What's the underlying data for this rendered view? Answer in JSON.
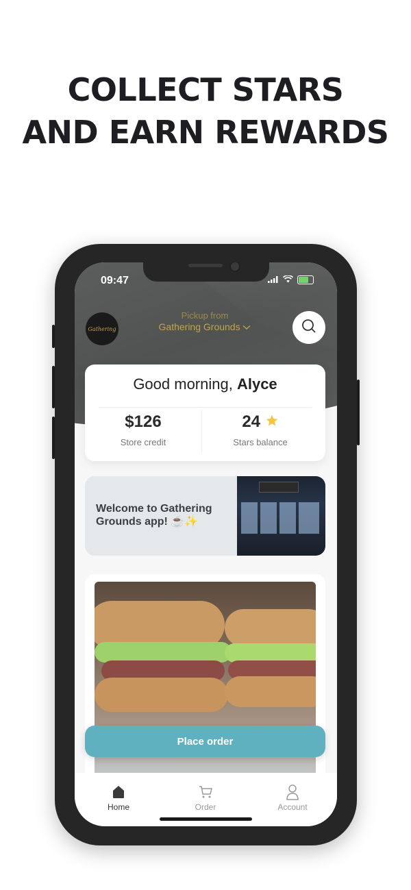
{
  "headline": {
    "line1": "COLLECT STARS",
    "line2": "AND EARN REWARDS"
  },
  "status_bar": {
    "time": "09:47"
  },
  "header": {
    "logo_text": "Gathering",
    "pickup_label": "Pickup from",
    "pickup_location": "Gathering Grounds",
    "chevron": "chevron-down-icon",
    "search_icon": "search-icon"
  },
  "greeting": {
    "prefix": "Good morning, ",
    "name": "Alyce",
    "store_credit_value": "$126",
    "store_credit_label": "Store credit",
    "stars_value": "24",
    "stars_label": "Stars balance"
  },
  "welcome": {
    "text": "Welcome to Gathering Grounds app! ☕✨"
  },
  "cta": {
    "place_order": "Place order"
  },
  "tabs": [
    {
      "label": "Home",
      "icon": "home-icon",
      "active": true
    },
    {
      "label": "Order",
      "icon": "cart-icon",
      "active": false
    },
    {
      "label": "Account",
      "icon": "user-icon",
      "active": false
    }
  ],
  "colors": {
    "accent": "#5fb1c0",
    "gold": "#c0a546",
    "star": "#f5c542"
  }
}
